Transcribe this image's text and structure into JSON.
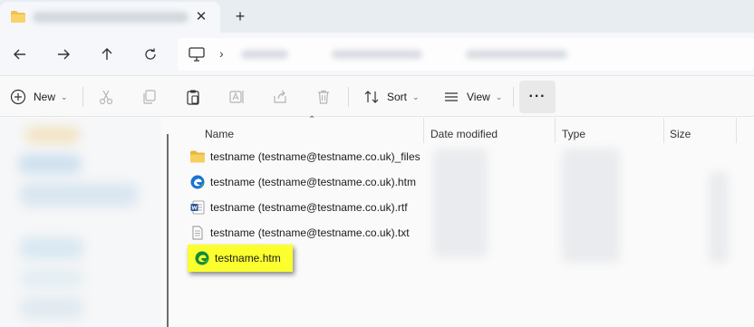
{
  "tab": {
    "icon": "folder-icon",
    "close_glyph": "✕",
    "new_tab_glyph": "+"
  },
  "nav": {
    "back_icon": "back-arrow-icon",
    "forward_icon": "forward-arrow-icon",
    "up_icon": "up-arrow-icon",
    "refresh_icon": "refresh-icon",
    "address_chevron": "›"
  },
  "commands": {
    "new_label": "New",
    "sort_label": "Sort",
    "view_label": "View",
    "more_label": "···"
  },
  "columns": {
    "name": "Name",
    "date": "Date modified",
    "type": "Type",
    "size": "Size"
  },
  "files": [
    {
      "name": "testname (testname@testname.co.uk)_files",
      "icon": "folder-icon"
    },
    {
      "name": "testname (testname@testname.co.uk).htm",
      "icon": "edge-icon"
    },
    {
      "name": "testname (testname@testname.co.uk).rtf",
      "icon": "word-icon"
    },
    {
      "name": "testname (testname@testname.co.uk).txt",
      "icon": "text-file-icon"
    }
  ],
  "highlighted_file": {
    "name": "testname.htm",
    "icon": "edge-icon",
    "highlight_color": "#fbff2e"
  },
  "colors": {
    "accent_folder": "#f2c14e",
    "edge_blue": "#1a73d4",
    "edge_green": "#3bb54a",
    "word_blue": "#2b5797"
  }
}
